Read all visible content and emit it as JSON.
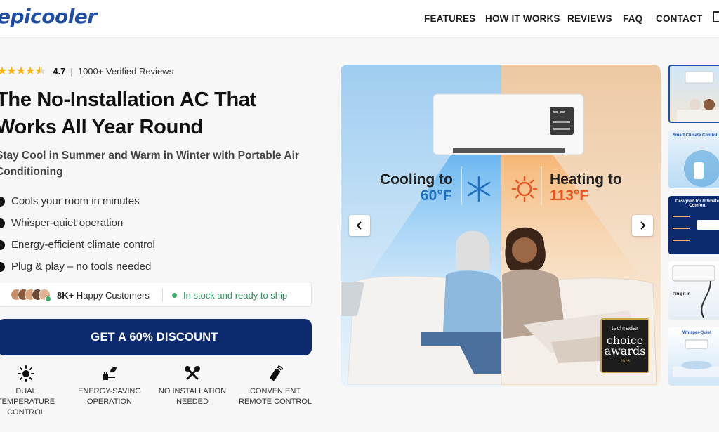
{
  "brand": {
    "logo": "epicooler"
  },
  "nav": {
    "items": [
      "FEATURES",
      "HOW IT WORKS",
      "REVIEWS",
      "FAQ",
      "CONTACT"
    ]
  },
  "icons": {
    "cart": "shopping-bag-icon",
    "star": "star-icon",
    "prev": "chevron-left-icon",
    "next": "chevron-right-icon"
  },
  "rating": {
    "score": "4.7",
    "reviews": "1000+ Verified Reviews",
    "stars": 4.5
  },
  "hero": {
    "title": "The No-Installation AC That Works All Year Round",
    "subtitle": "Stay Cool in Summer and Warm in Winter with Portable Air Conditioning"
  },
  "features": [
    "Cools your room in minutes",
    "Whisper-quiet operation",
    "Energy-efficient climate control",
    "Plug & play – no tools needed"
  ],
  "social_proof": {
    "count": "8K+",
    "customers_label": "Happy Customers",
    "stock": "In stock and ready to ship"
  },
  "cta": {
    "label": "GET A 60% DISCOUNT"
  },
  "badges": [
    {
      "icon": "sun-snowflake-icon",
      "label": "DUAL TEMPERATURE CONTROL"
    },
    {
      "icon": "plug-leaf-icon",
      "label": "ENERGY-SAVING OPERATION"
    },
    {
      "icon": "tools-crossed-icon",
      "label": "NO INSTALLATION NEEDED"
    },
    {
      "icon": "remote-control-icon",
      "label": "CONVENIENT REMOTE CONTROL"
    }
  ],
  "gallery": {
    "cooling_label": "Cooling to",
    "cooling_temp": "60°F",
    "heating_label": "Heating to",
    "heating_temp": "113°F",
    "award": {
      "source": "techradar",
      "title": "choice awards",
      "year": "2025"
    },
    "thumbnails": [
      {
        "caption": ""
      },
      {
        "caption": "Smart Climate Control"
      },
      {
        "caption": "Designed for Ultimate Comfort"
      },
      {
        "caption": "Plug it in"
      },
      {
        "caption": "Whisper-Quiet"
      }
    ]
  },
  "colors": {
    "brand_blue": "#1f4ea6",
    "cta_navy": "#0d2a6e",
    "star_gold": "#f4b400",
    "stock_green": "#2e8b57",
    "cool_blue": "#1f6fc0",
    "heat_orange": "#e8531f"
  }
}
